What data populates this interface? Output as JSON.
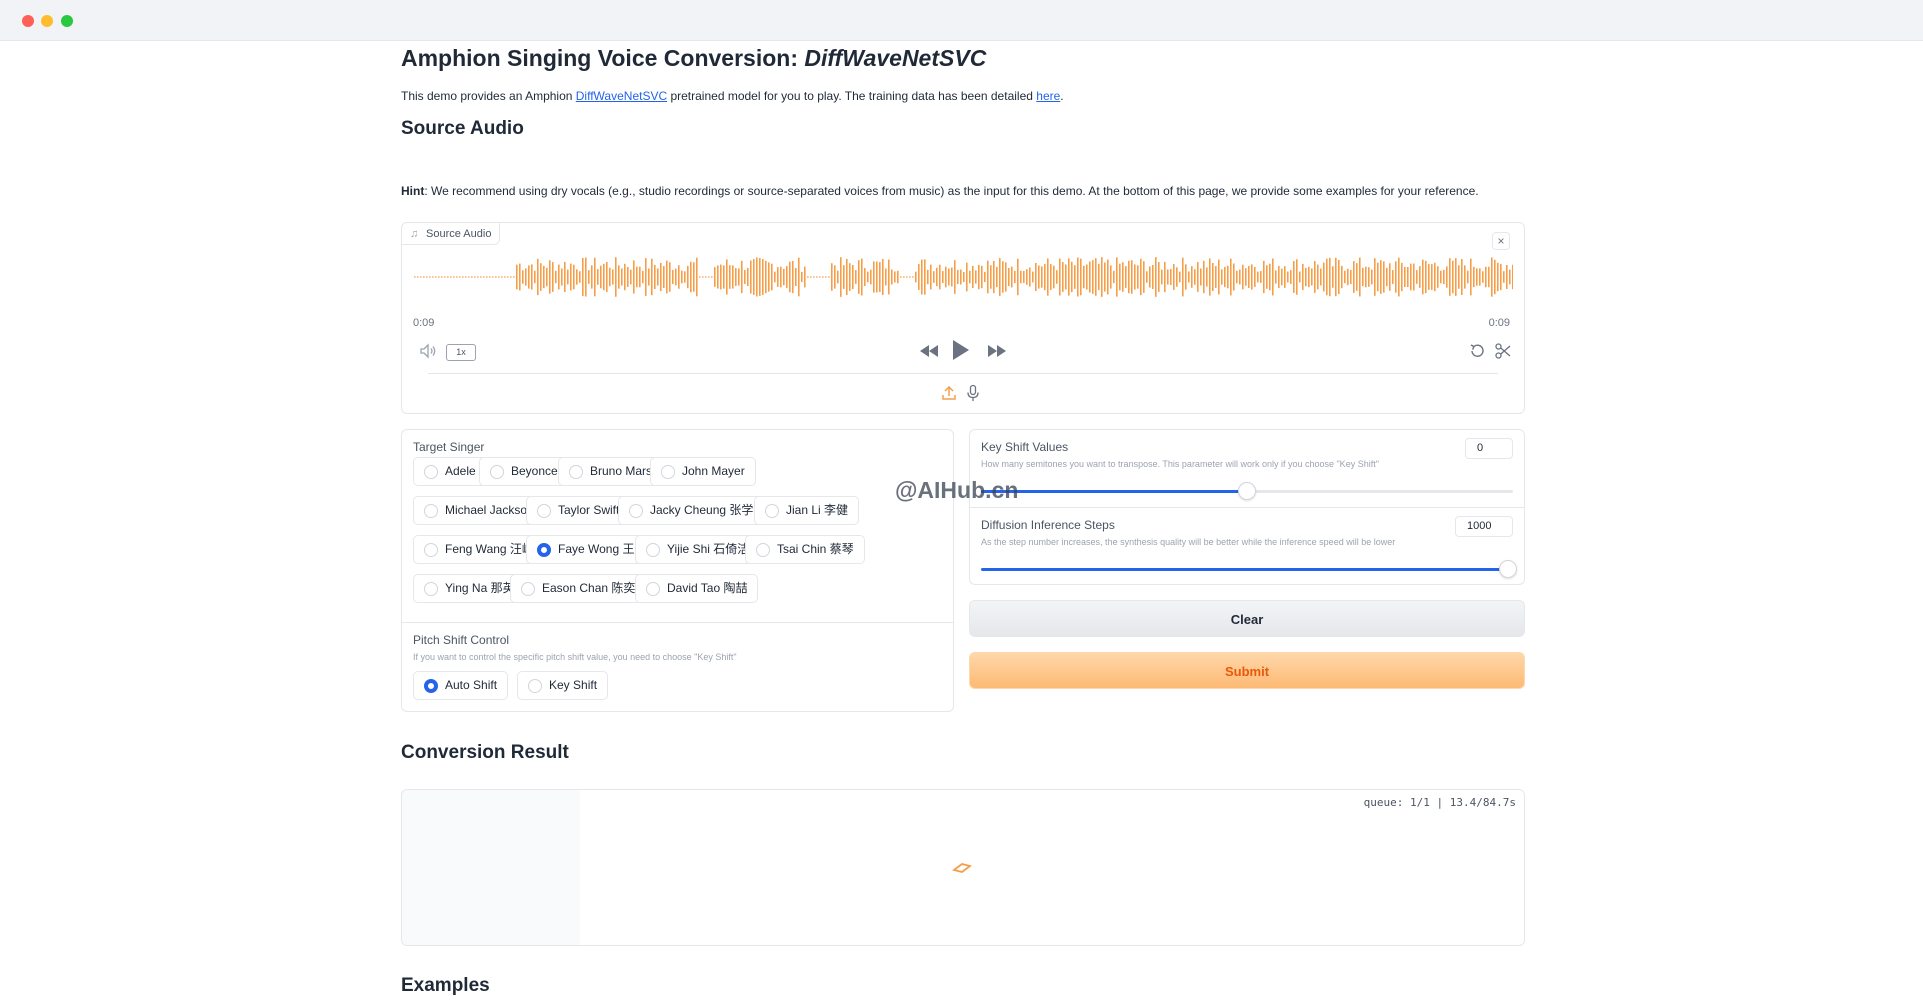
{
  "window": {
    "controls": [
      "close",
      "minimize",
      "maximize"
    ]
  },
  "header": {
    "title_prefix": "Amphion Singing Voice Conversion: ",
    "title_model": "DiffWaveNetSVC",
    "intro_before": "This demo provides an Amphion ",
    "intro_link": "DiffWaveNetSVC",
    "intro_middle": " pretrained model for you to play. The training data has been detailed ",
    "intro_here": "here",
    "intro_end": "."
  },
  "source": {
    "heading": "Source Audio",
    "hint_label": "Hint",
    "hint_text": ": We recommend using dry vocals (e.g., studio recordings or source-separated voices from music) as the input for this demo. At the bottom of this page, we provide some examples for your reference."
  },
  "audio": {
    "label": "Source Audio",
    "close": "×",
    "time_current": "0:09",
    "time_total": "0:09",
    "speed": "1x",
    "wave_color": "#f59e4a",
    "icons": [
      "music-note-icon",
      "volume-icon",
      "rewind-icon",
      "play-icon",
      "fast-forward-icon",
      "undo-icon",
      "scissors-icon",
      "upload-icon",
      "microphone-icon"
    ]
  },
  "target": {
    "label": "Target Singer",
    "selected": "Faye Wong 王菲",
    "options": [
      "Adele",
      "Beyonce",
      "Bruno Mars",
      "John Mayer",
      "Michael Jackson",
      "Taylor Swift",
      "Jacky Cheung 张学友",
      "Jian Li 李健",
      "Feng Wang 汪峰",
      "Faye Wong 王菲",
      "Yijie Shi 石倚洁",
      "Tsai Chin 蔡琴",
      "Ying Na 那英",
      "Eason Chan 陈奕迅",
      "David Tao 陶喆"
    ]
  },
  "pitch": {
    "label": "Pitch Shift Control",
    "info": "If you want to control the specific pitch shift value, you need to choose \"Key Shift\"",
    "selected": "Auto Shift",
    "options": [
      "Auto Shift",
      "Key Shift"
    ]
  },
  "key_shift": {
    "label": "Key Shift Values",
    "info": "How many semitones you want to transpose. This parameter will work only if you choose \"Key Shift\"",
    "value": "0",
    "fraction": 0.5
  },
  "diffusion": {
    "label": "Diffusion Inference Steps",
    "info": "As the step number increases, the synthesis quality will be better while the inference speed will be lower",
    "value": "1000",
    "fraction": 0.99
  },
  "actions": {
    "clear": "Clear",
    "submit": "Submit"
  },
  "result": {
    "heading": "Conversion Result",
    "queue": "queue: 1/1 | 13.4/84.7s"
  },
  "examples": {
    "heading": "Examples"
  },
  "watermark": "@AIHub.cn",
  "colors": {
    "accent": "#2563eb",
    "submit_text": "#ea580c",
    "wave": "#f59e4a"
  }
}
